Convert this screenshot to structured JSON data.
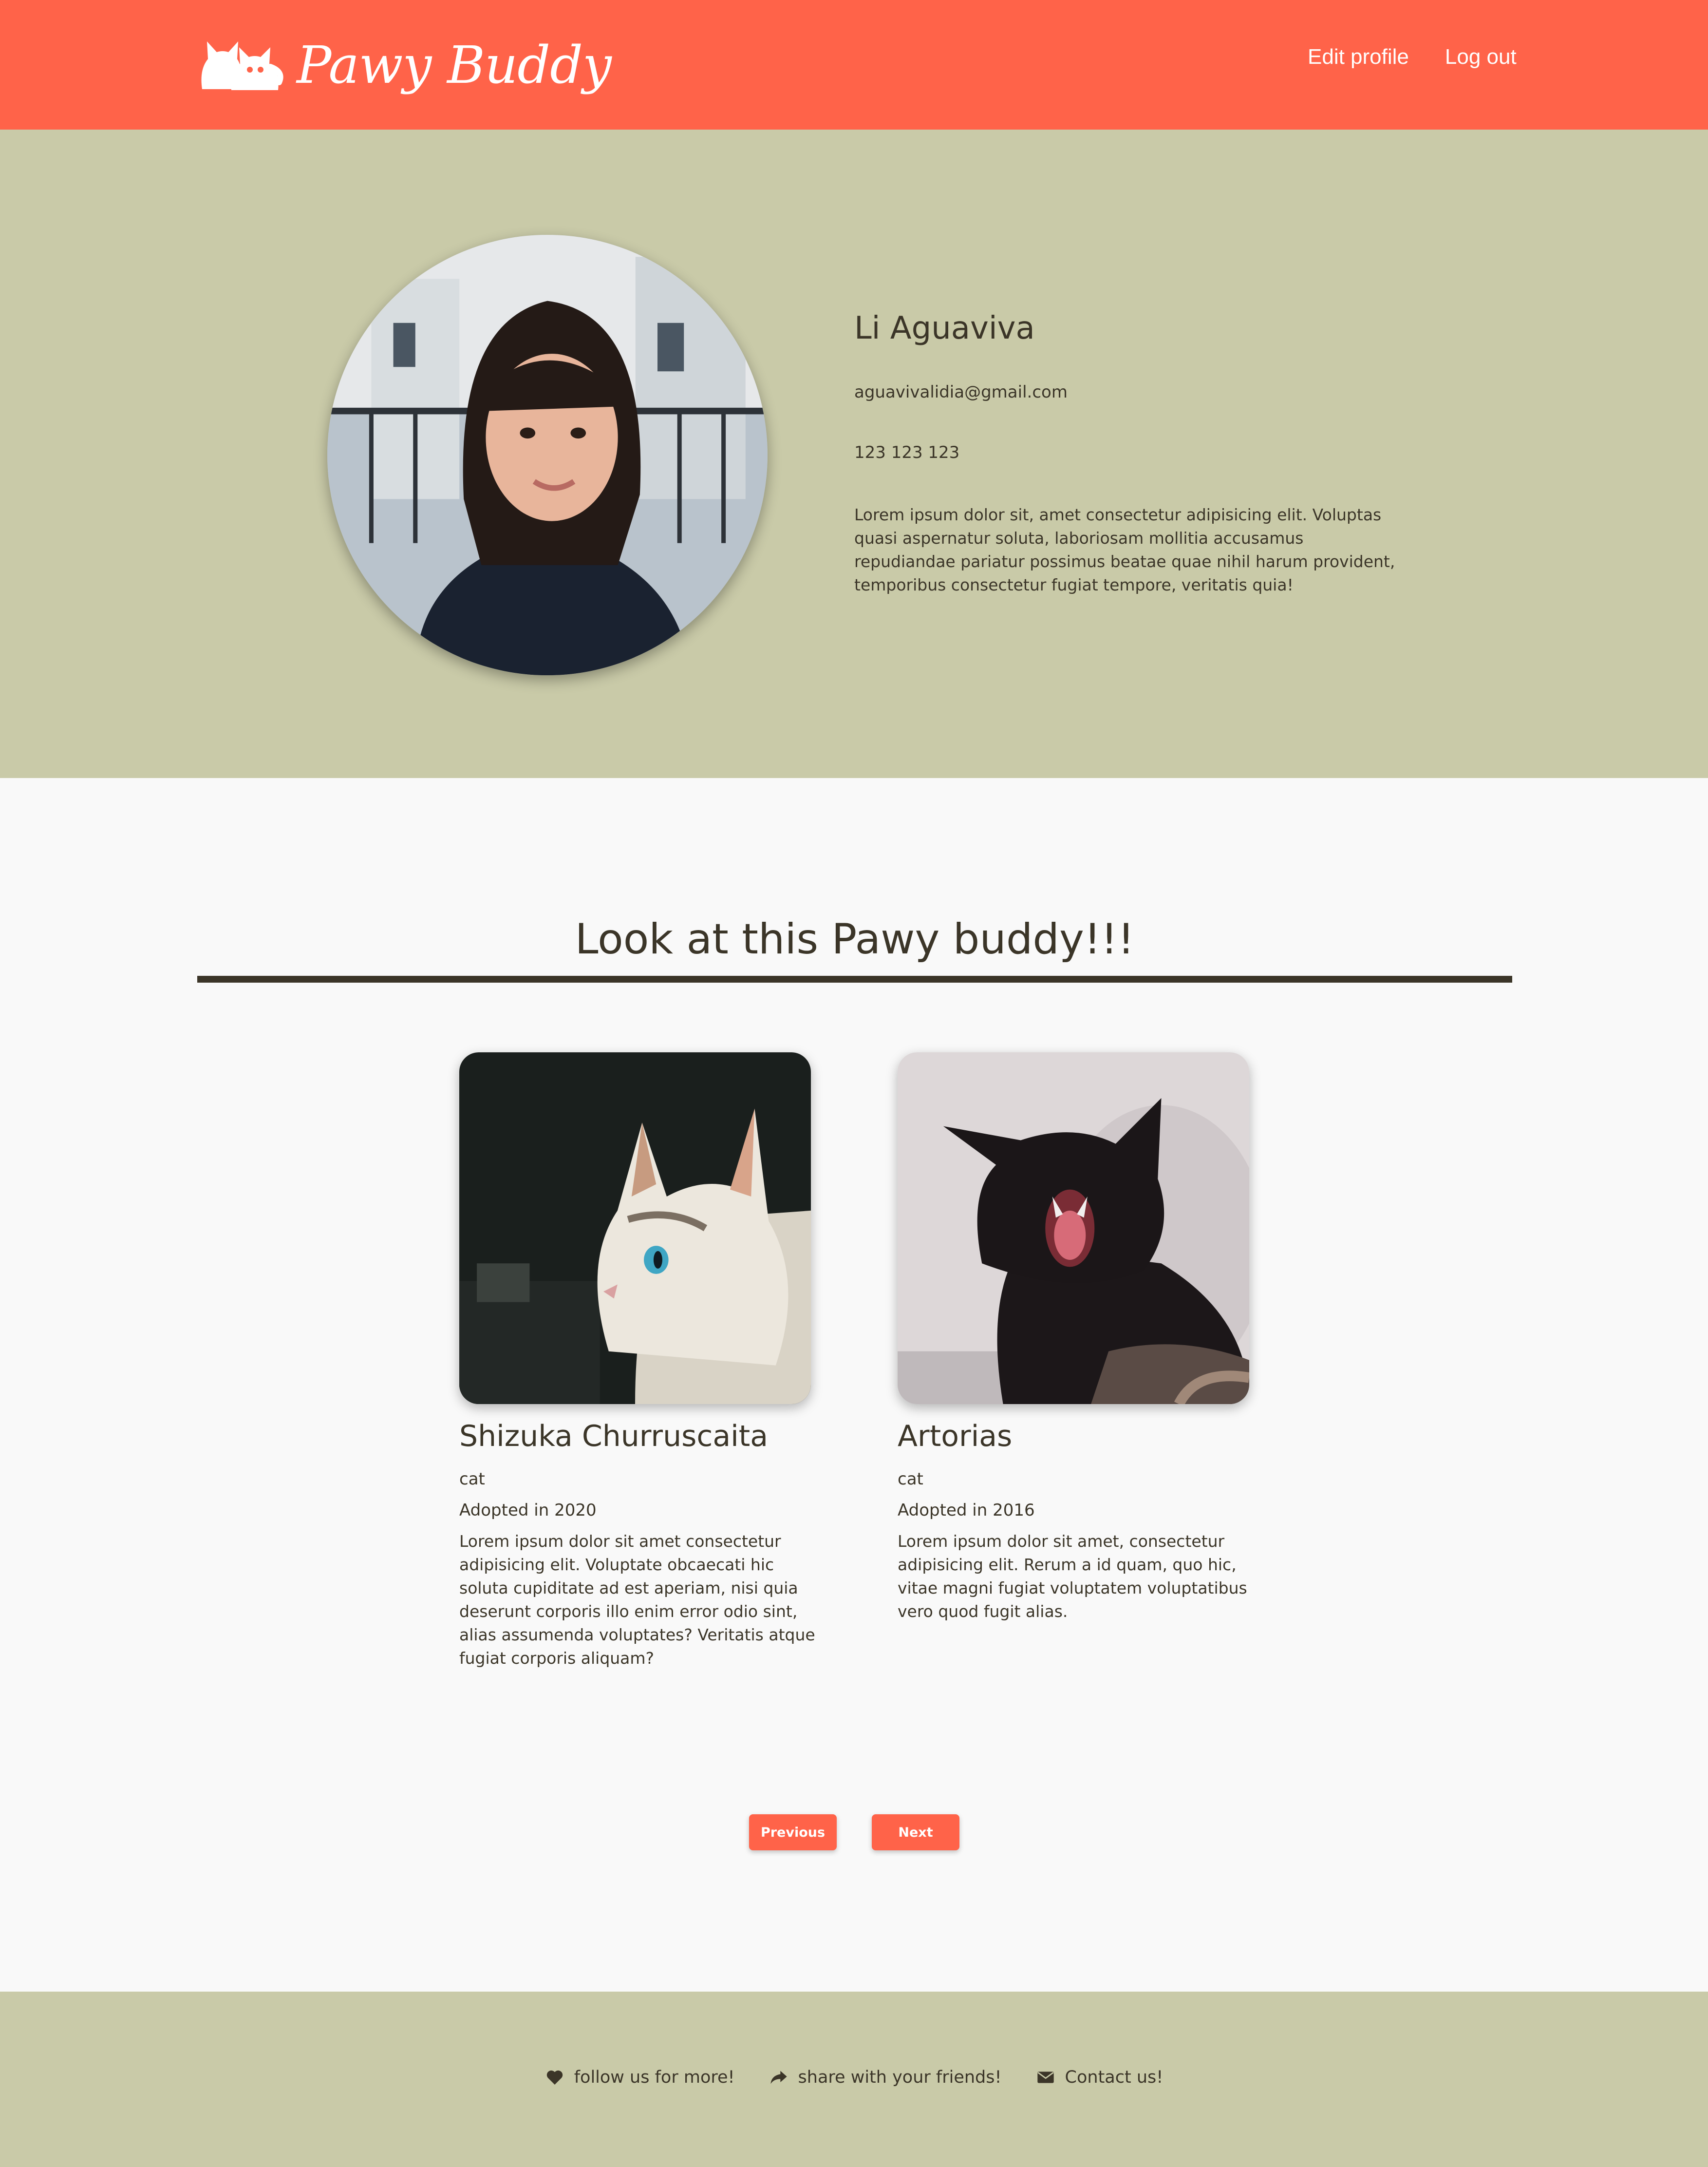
{
  "brand": {
    "name": "Pawy Buddy",
    "logo_icon": "cats-logo-icon",
    "primary_color": "#ff6349",
    "secondary_color": "#c9caa8",
    "text_color": "#3b3528"
  },
  "nav": {
    "edit_profile": "Edit profile",
    "log_out": "Log out"
  },
  "profile": {
    "name": "Li Aguaviva",
    "email": "aguavivalidia@gmail.com",
    "phone": "123 123 123",
    "bio": "Lorem ipsum dolor sit, amet consectetur adipisicing elit. Voluptas quasi aspernatur soluta, laboriosam mollitia accusamus repudiandae pariatur possimus beatae quae nihil harum provident, temporibus consectetur fugiat tempore, veritatis quia!"
  },
  "pets_section": {
    "title": "Look at this Pawy buddy!!!"
  },
  "pets": [
    {
      "name": "Shizuka Churruscaita",
      "species": "cat",
      "adopted": "Adopted in 2020",
      "description": "Lorem ipsum dolor sit amet consectetur adipisicing elit. Voluptate obcaecati hic soluta cupiditate ad est aperiam, nisi quia deserunt corporis illo enim error odio sint, alias assumenda voluptates? Veritatis atque fugiat corporis aliquam?"
    },
    {
      "name": "Artorias",
      "species": "cat",
      "adopted": "Adopted in 2016",
      "description": "Lorem ipsum dolor sit amet, consectetur adipisicing elit. Rerum a id quam, quo hic, vitae magni fugiat voluptatem voluptatibus vero quod fugit alias."
    }
  ],
  "pagination": {
    "previous": "Previous",
    "next": "Next"
  },
  "footer": {
    "links": [
      {
        "icon": "heart-icon",
        "label": "follow us for more!"
      },
      {
        "icon": "share-icon",
        "label": "share with your friends!"
      },
      {
        "icon": "envelope-icon",
        "label": "Contact us!"
      }
    ]
  }
}
